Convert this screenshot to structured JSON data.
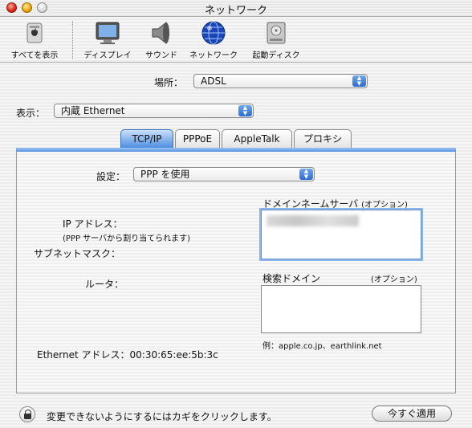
{
  "window": {
    "title": "ネットワーク"
  },
  "toolbar": {
    "items": [
      {
        "label": "すべてを表示",
        "icon": "apple-switch-icon"
      },
      {
        "label": "ディスプレイ",
        "icon": "display-icon"
      },
      {
        "label": "サウンド",
        "icon": "speaker-icon"
      },
      {
        "label": "ネットワーク",
        "icon": "globe-icon"
      },
      {
        "label": "起動ディスク",
        "icon": "startup-disk-icon"
      }
    ]
  },
  "location": {
    "label": "場所：",
    "value": "ADSL"
  },
  "show": {
    "label": "表示：",
    "value": "内蔵 Ethernet"
  },
  "tabs": [
    {
      "label": "TCP/IP",
      "active": true
    },
    {
      "label": "PPPoE",
      "active": false
    },
    {
      "label": "AppleTalk",
      "active": false
    },
    {
      "label": "プロキシ",
      "active": false
    }
  ],
  "config": {
    "label": "設定：",
    "value": "PPP を使用"
  },
  "fields": {
    "ip_label": "IP アドレス：",
    "ip_note": "(PPP サーバから割り当てられます)",
    "subnet_label": "サブネットマスク：",
    "router_label": "ルータ：",
    "ethernet_address": "Ethernet アドレス：00:30:65:ee:5b:3c"
  },
  "dns": {
    "label": "ドメインネームサーバ",
    "optional": "(オプション)"
  },
  "search": {
    "label": "検索ドメイン",
    "optional": "(オプション)",
    "example": "例：apple.co.jp、earthlink.net"
  },
  "footer": {
    "lock_text": "変更できないようにするにはカギをクリックします。",
    "apply_label": "今すぐ適用"
  },
  "colors": {
    "accent": "#4f8ee0",
    "close": "#e0281b",
    "minimize": "#f0a810"
  }
}
